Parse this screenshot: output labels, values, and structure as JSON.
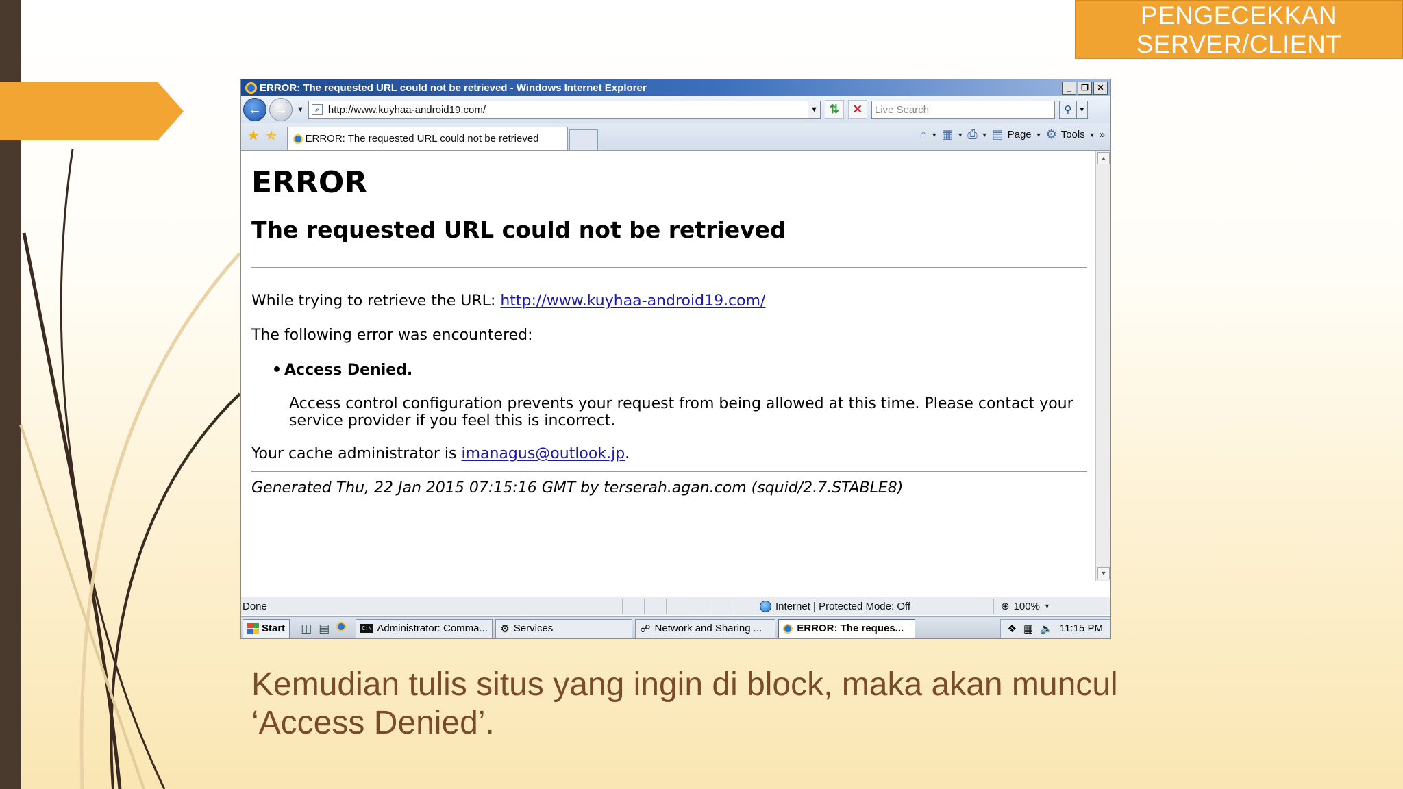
{
  "slide": {
    "title_lines": [
      "PENGECEKKAN",
      "SERVER/CLIENT"
    ],
    "caption_lines": [
      "Kemudian tulis situs yang ingin di block, maka akan muncul",
      "‘Access Denied’."
    ],
    "colors": {
      "accent": "#f0a330",
      "dark_bar": "#4a3a2e",
      "caption": "#7a4b2a"
    }
  },
  "browser": {
    "title": "ERROR: The requested URL could not be retrieved - Windows Internet Explorer",
    "window_buttons": [
      "_",
      "❐",
      "✕"
    ],
    "address": "http://www.kuyhaa-android19.com/",
    "search_placeholder": "Live Search",
    "tab_title": "ERROR: The requested URL could not be retrieved",
    "command_bar": {
      "page": "Page",
      "tools": "Tools",
      "more": "»"
    },
    "status": {
      "left": "Done",
      "zone": "Internet | Protected Mode: Off",
      "zoom": "100%"
    }
  },
  "error_page": {
    "heading": "ERROR",
    "subheading": "The requested URL could not be retrieved",
    "retrieve_label": "While trying to retrieve the URL:",
    "retrieve_url": "http://www.kuyhaa-android19.com/",
    "encountered": "The following error was encountered:",
    "bullet": "Access Denied.",
    "detail": "Access control configuration prevents your request from being allowed at this time. Please contact your service provider if you feel this is incorrect.",
    "admin_label": "Your cache administrator is",
    "admin_email": "imanagus@outlook.jp",
    "admin_suffix": ".",
    "generated": "Generated Thu, 22 Jan 2015 07:15:16 GMT by terserah.agan.com (squid/2.7.STABLE8)"
  },
  "taskbar": {
    "start": "Start",
    "tasks": [
      "Administrator: Comma...",
      "Services",
      "Network and Sharing ...",
      "ERROR: The reques..."
    ],
    "clock": "11:15 PM"
  }
}
